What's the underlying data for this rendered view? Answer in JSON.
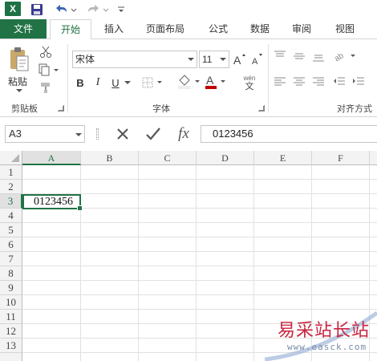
{
  "app": {
    "logo_letter": "X"
  },
  "tabs": [
    "文件",
    "开始",
    "插入",
    "页面布局",
    "公式",
    "数据",
    "审阅",
    "视图"
  ],
  "ribbon": {
    "paste_label": "粘贴",
    "clipboard_group": "剪贴板",
    "font_group": "字体",
    "alignment_group": "对齐方式",
    "font_name": "宋体",
    "font_size": "11",
    "bold": "B",
    "italic": "I",
    "underline": "U",
    "phonetic_label": "wén",
    "phonetic_char": "文"
  },
  "formula_bar": {
    "name_box": "A3",
    "formula_value": "0123456",
    "fx_label": "fx"
  },
  "sheet": {
    "columns": [
      "A",
      "B",
      "C",
      "D",
      "E",
      "F"
    ],
    "rows": [
      "1",
      "2",
      "3",
      "4",
      "5",
      "6",
      "7",
      "8",
      "9",
      "10",
      "11",
      "12",
      "13"
    ],
    "active_cell": "A3",
    "cell_a3_value": "0123456"
  },
  "watermark": {
    "title": "易采站长站",
    "url": "www.easck.com"
  },
  "colors": {
    "excel_green": "#217346",
    "logo_green": "#1e7145",
    "watermark_red": "#c8253f"
  }
}
